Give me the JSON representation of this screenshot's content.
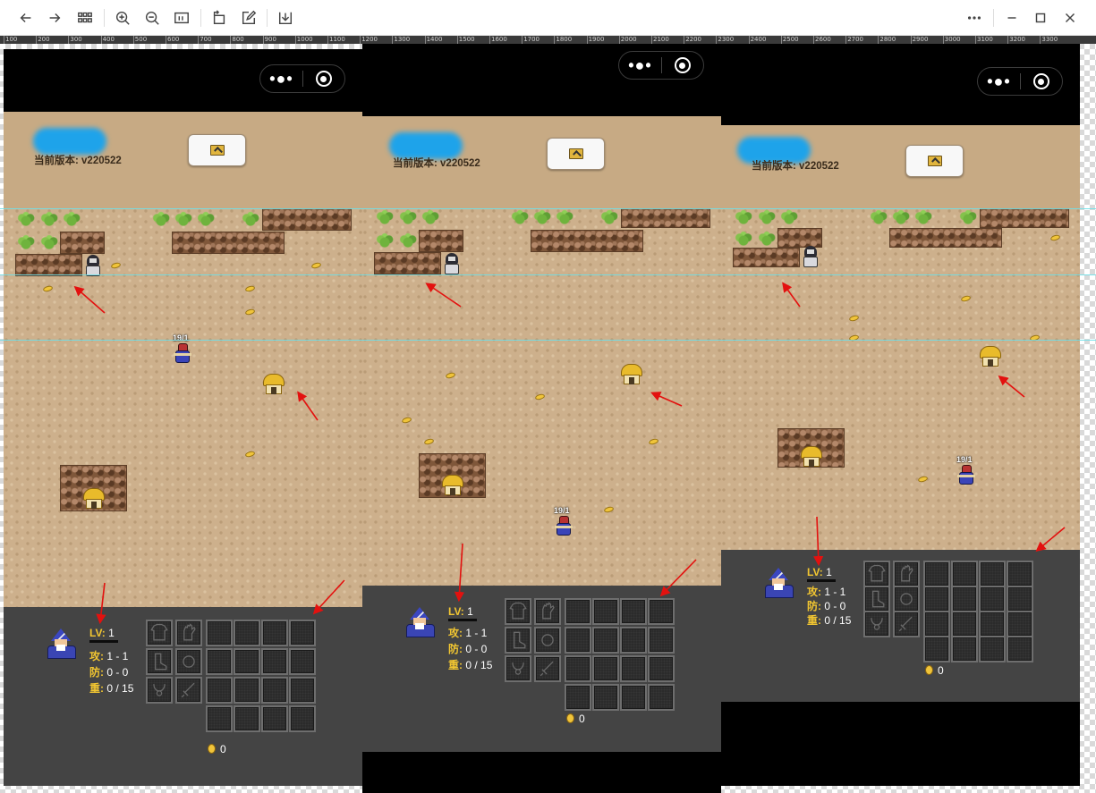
{
  "viewer": {
    "toolbar_icons": [
      "back-arrow-icon",
      "forward-arrow-icon",
      "grid-view-icon",
      "zoom-in-icon",
      "zoom-out-icon",
      "actual-size-icon",
      "rotate-icon",
      "edit-icon",
      "download-icon"
    ],
    "window_controls": [
      "more-icon",
      "minimize-icon",
      "maximize-icon",
      "close-icon"
    ],
    "ruler_labels": [
      "100",
      "200",
      "300",
      "400",
      "500",
      "600",
      "700",
      "800",
      "900",
      "1000",
      "1100",
      "1200",
      "1300",
      "1400",
      "1500",
      "1600",
      "1700",
      "1800",
      "1900",
      "2000",
      "2100",
      "2200",
      "2300",
      "2400",
      "2500",
      "2600",
      "2700",
      "2800",
      "2900",
      "3000",
      "3100",
      "3200",
      "3300"
    ]
  },
  "screens": [
    {
      "menu_dots": "•●•",
      "version": "当前版本: v220522",
      "hero_label": "19/1",
      "stats": {
        "lv_key": "LV:",
        "lv_val": "1",
        "atk_key": "攻:",
        "atk_val": "1 - 1",
        "def_key": "防:",
        "def_val": "0 - 0",
        "wt_key": "重:",
        "wt_val": "0 / 15"
      },
      "gold": "0"
    },
    {
      "menu_dots": "•●•",
      "version": "当前版本: v220522",
      "hero_label": "19/1",
      "stats": {
        "lv_key": "LV:",
        "lv_val": "1",
        "atk_key": "攻:",
        "atk_val": "1 - 1",
        "def_key": "防:",
        "def_val": "0 - 0",
        "wt_key": "重:",
        "wt_val": "0 / 15"
      },
      "gold": "0"
    },
    {
      "menu_dots": "•●•",
      "version": "当前版本: v220522",
      "hero_label": "19/1",
      "stats": {
        "lv_key": "LV:",
        "lv_val": "1",
        "atk_key": "攻:",
        "atk_val": "1 - 1",
        "def_key": "防:",
        "def_val": "0 - 0",
        "wt_key": "重:",
        "wt_val": "0 / 15"
      },
      "gold": "0"
    }
  ],
  "equipment_icons": [
    "armor-icon",
    "glove-icon",
    "boot-icon",
    "ring-icon",
    "necklace-icon",
    "sword-icon"
  ],
  "colors": {
    "sand": "#cdb08c",
    "header_sand": "#c7aa84",
    "panel": "#444444",
    "stat_key": "#f2c631",
    "annotation_arrow": "#e3110f",
    "guide_line": "#6fe0e8"
  }
}
